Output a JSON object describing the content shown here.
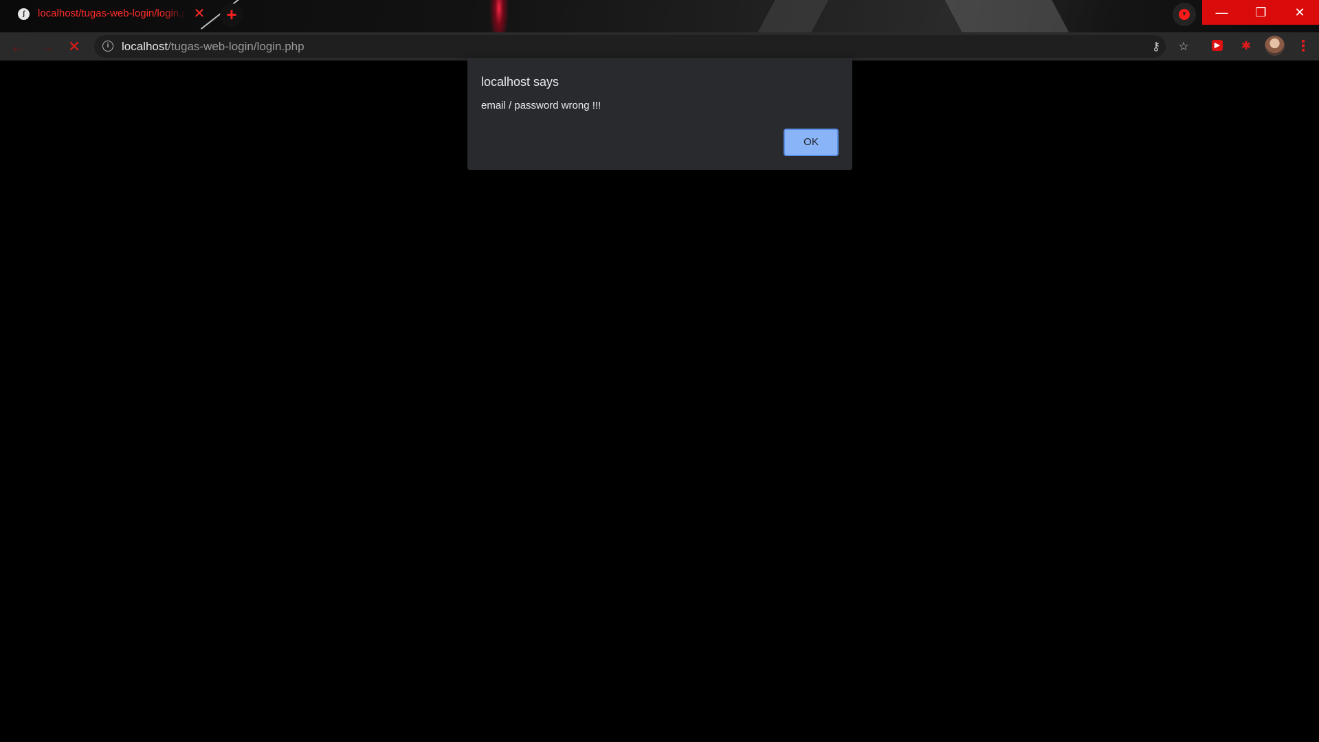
{
  "browser": {
    "tab": {
      "title": "localhost/tugas-web-login/login.php",
      "favicon_label": "ʃ",
      "close_glyph": "✕"
    },
    "new_tab_glyph": "+",
    "window_controls": {
      "minimize": "—",
      "restore": "❐",
      "close": "✕"
    },
    "toolbar": {
      "back_glyph": "←",
      "forward_glyph": "→",
      "stop_glyph": "✕",
      "info_glyph": "i",
      "url_host": "localhost",
      "url_path": "/tugas-web-login/login.php",
      "key_glyph": "⚷",
      "star_glyph": "☆",
      "ext1_glyph": "▶",
      "ext2_glyph": "✱",
      "menu_glyph": "⋮"
    },
    "icons": {
      "tab_favicon": "site-favicon-icon",
      "tab_close": "close-icon",
      "new_tab": "plus-icon",
      "tab_search": "tab-search-icon",
      "back": "arrow-left-icon",
      "forward": "arrow-right-icon",
      "stop": "stop-icon",
      "site_info": "info-icon",
      "passwords": "key-icon",
      "bookmark": "star-icon",
      "extension_1": "extension-icon",
      "extensions": "puzzle-icon",
      "profile": "avatar",
      "menu": "kebab-menu-icon"
    },
    "colors": {
      "accent": "#ff2b2b",
      "window_control_bg": "#d90b0b",
      "toolbar_bg": "#2a2a2b",
      "page_bg": "#000000"
    }
  },
  "dialog": {
    "title": "localhost says",
    "message": "email / password wrong !!!",
    "ok_label": "OK",
    "colors": {
      "background": "#292a2d",
      "button_bg": "#8ab4f8",
      "text": "#e8eaed"
    }
  }
}
